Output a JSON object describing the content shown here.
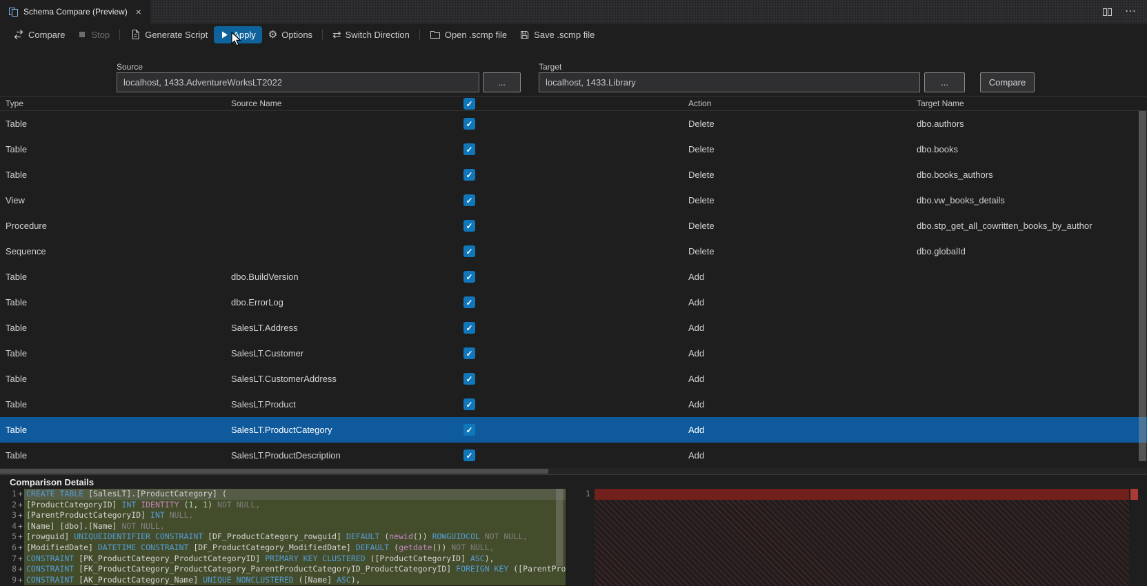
{
  "window": {
    "tab_title": "Schema Compare (Preview)"
  },
  "icons": {
    "close": "×",
    "ellipsis": "⋯",
    "gear": "⚙",
    "switch": "⇄",
    "check": "✓"
  },
  "toolbar": {
    "items": [
      {
        "label": "Compare"
      },
      {
        "label": "Stop"
      },
      {
        "label": "Generate Script"
      },
      {
        "label": "Apply"
      },
      {
        "label": "Options"
      },
      {
        "label": "Switch Direction"
      },
      {
        "label": "Open .scmp file"
      },
      {
        "label": "Save .scmp file"
      }
    ]
  },
  "connections": {
    "source_label": "Source",
    "source_value": "localhost, 1433.AdventureWorksLT2022",
    "target_label": "Target",
    "target_value": "localhost, 1433.Library",
    "browse_label": "...",
    "compare_button": "Compare"
  },
  "grid": {
    "headers": {
      "type": "Type",
      "source": "Source Name",
      "action": "Action",
      "target": "Target Name"
    },
    "rows": [
      {
        "type": "Table",
        "source": "",
        "checked": true,
        "action": "Delete",
        "target": "dbo.authors",
        "selected": false
      },
      {
        "type": "Table",
        "source": "",
        "checked": true,
        "action": "Delete",
        "target": "dbo.books",
        "selected": false
      },
      {
        "type": "Table",
        "source": "",
        "checked": true,
        "action": "Delete",
        "target": "dbo.books_authors",
        "selected": false
      },
      {
        "type": "View",
        "source": "",
        "checked": true,
        "action": "Delete",
        "target": "dbo.vw_books_details",
        "selected": false
      },
      {
        "type": "Procedure",
        "source": "",
        "checked": true,
        "action": "Delete",
        "target": "dbo.stp_get_all_cowritten_books_by_author",
        "selected": false
      },
      {
        "type": "Sequence",
        "source": "",
        "checked": true,
        "action": "Delete",
        "target": "dbo.globalId",
        "selected": false
      },
      {
        "type": "Table",
        "source": "dbo.BuildVersion",
        "checked": true,
        "action": "Add",
        "target": "",
        "selected": false
      },
      {
        "type": "Table",
        "source": "dbo.ErrorLog",
        "checked": true,
        "action": "Add",
        "target": "",
        "selected": false
      },
      {
        "type": "Table",
        "source": "SalesLT.Address",
        "checked": true,
        "action": "Add",
        "target": "",
        "selected": false
      },
      {
        "type": "Table",
        "source": "SalesLT.Customer",
        "checked": true,
        "action": "Add",
        "target": "",
        "selected": false
      },
      {
        "type": "Table",
        "source": "SalesLT.CustomerAddress",
        "checked": true,
        "action": "Add",
        "target": "",
        "selected": false
      },
      {
        "type": "Table",
        "source": "SalesLT.Product",
        "checked": true,
        "action": "Add",
        "target": "",
        "selected": false
      },
      {
        "type": "Table",
        "source": "SalesLT.ProductCategory",
        "checked": true,
        "action": "Add",
        "target": "",
        "selected": true
      },
      {
        "type": "Table",
        "source": "SalesLT.ProductDescription",
        "checked": true,
        "action": "Add",
        "target": "",
        "selected": false
      }
    ]
  },
  "details": {
    "title": "Comparison Details",
    "plus": "+",
    "right_first_line_number": "1",
    "left_lines": [
      {
        "num": "1",
        "cls": "sel",
        "segs": [
          [
            "kw",
            "CREATE TABLE "
          ],
          [
            "pl",
            "[SalesLT].[ProductCategory] ("
          ]
        ]
      },
      {
        "num": "2",
        "segs": [
          [
            "pl",
            "[ProductCategoryID] "
          ],
          [
            "kw",
            "INT "
          ],
          [
            "fn",
            "IDENTITY "
          ],
          [
            "pl",
            "("
          ],
          [
            "nm",
            "1"
          ],
          [
            "pl",
            ", "
          ],
          [
            "nm",
            "1"
          ],
          [
            "pl",
            ") "
          ],
          [
            "gr",
            "NOT NULL,"
          ]
        ]
      },
      {
        "num": "3",
        "segs": [
          [
            "pl",
            "[ParentProductCategoryID] "
          ],
          [
            "kw",
            "INT "
          ],
          [
            "gr",
            "NULL,"
          ]
        ]
      },
      {
        "num": "4",
        "segs": [
          [
            "pl",
            "[Name] [dbo].[Name] "
          ],
          [
            "gr",
            "NOT NULL,"
          ]
        ]
      },
      {
        "num": "5",
        "segs": [
          [
            "pl",
            "[rowguid] "
          ],
          [
            "kw",
            "UNIQUEIDENTIFIER CONSTRAINT "
          ],
          [
            "pl",
            "[DF_ProductCategory_rowguid] "
          ],
          [
            "kw",
            "DEFAULT "
          ],
          [
            "pl",
            "("
          ],
          [
            "fn",
            "newid"
          ],
          [
            "pl",
            "()) "
          ],
          [
            "kw",
            "ROWGUIDCOL "
          ],
          [
            "gr",
            "NOT NULL,"
          ]
        ]
      },
      {
        "num": "6",
        "segs": [
          [
            "pl",
            "[ModifiedDate] "
          ],
          [
            "kw",
            "DATETIME CONSTRAINT "
          ],
          [
            "pl",
            "[DF_ProductCategory_ModifiedDate] "
          ],
          [
            "kw",
            "DEFAULT "
          ],
          [
            "pl",
            "("
          ],
          [
            "fn",
            "getdate"
          ],
          [
            "pl",
            "()) "
          ],
          [
            "gr",
            "NOT NULL,"
          ]
        ]
      },
      {
        "num": "7",
        "segs": [
          [
            "kw",
            "CONSTRAINT "
          ],
          [
            "pl",
            "[PK_ProductCategory_ProductCategoryID] "
          ],
          [
            "kw",
            "PRIMARY KEY CLUSTERED "
          ],
          [
            "pl",
            "([ProductCategoryID] "
          ],
          [
            "kw",
            "ASC"
          ],
          [
            "pl",
            "),"
          ]
        ]
      },
      {
        "num": "8",
        "segs": [
          [
            "kw",
            "CONSTRAINT "
          ],
          [
            "pl",
            "[FK_ProductCategory_ProductCategory_ParentProductCategoryID_ProductCategoryID] "
          ],
          [
            "kw",
            "FOREIGN KEY "
          ],
          [
            "pl",
            "([ParentProductCatego"
          ]
        ]
      },
      {
        "num": "9",
        "segs": [
          [
            "kw",
            "CONSTRAINT "
          ],
          [
            "pl",
            "[AK_ProductCategory_Name] "
          ],
          [
            "kw",
            "UNIQUE NONCLUSTERED "
          ],
          [
            "pl",
            "([Name] "
          ],
          [
            "kw",
            "ASC"
          ],
          [
            "pl",
            "),"
          ]
        ]
      }
    ]
  },
  "colors": {
    "accent": "#0e639c",
    "checkbox_blue": "#1177bb",
    "row_selection": "#0e5a9c",
    "diff_add_bg": "#434d2b",
    "diff_del_bg": "#72201c"
  }
}
